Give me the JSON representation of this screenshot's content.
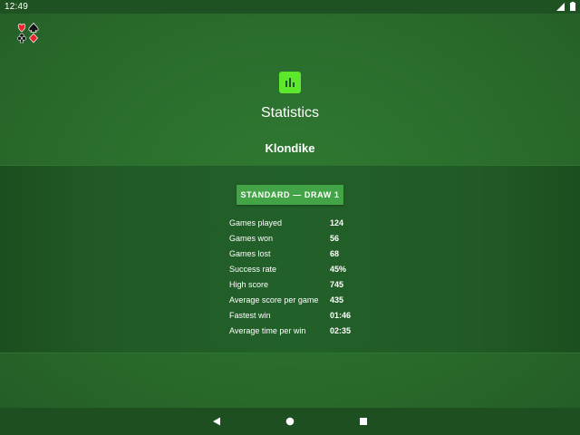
{
  "status_bar": {
    "time": "12:49",
    "icons": [
      "signal-icon",
      "battery-icon"
    ]
  },
  "app": {
    "logo_icon": "card-suits-logo-icon"
  },
  "header": {
    "icon": "bar-chart-icon",
    "title": "Statistics",
    "game_name": "Klondike"
  },
  "mode": {
    "label": "STANDARD — DRAW 1"
  },
  "stats": [
    {
      "label": "Games played",
      "value": "124"
    },
    {
      "label": "Games won",
      "value": "56"
    },
    {
      "label": "Games lost",
      "value": "68"
    },
    {
      "label": "Success rate",
      "value": "45%"
    },
    {
      "label": "High score",
      "value": "745"
    },
    {
      "label": "Average score per game",
      "value": "435"
    },
    {
      "label": "Fastest win",
      "value": "01:46"
    },
    {
      "label": "Average time per win",
      "value": "02:35"
    }
  ],
  "nav_bar": {
    "icons": [
      "back-icon",
      "home-icon",
      "recents-icon"
    ]
  },
  "colors": {
    "felt": "#2a6b2c",
    "panel": "#215a24",
    "accent_button": "#43a447",
    "stats_icon": "#5ee82c",
    "suit_red": "#e8232a",
    "suit_black": "#111111"
  }
}
